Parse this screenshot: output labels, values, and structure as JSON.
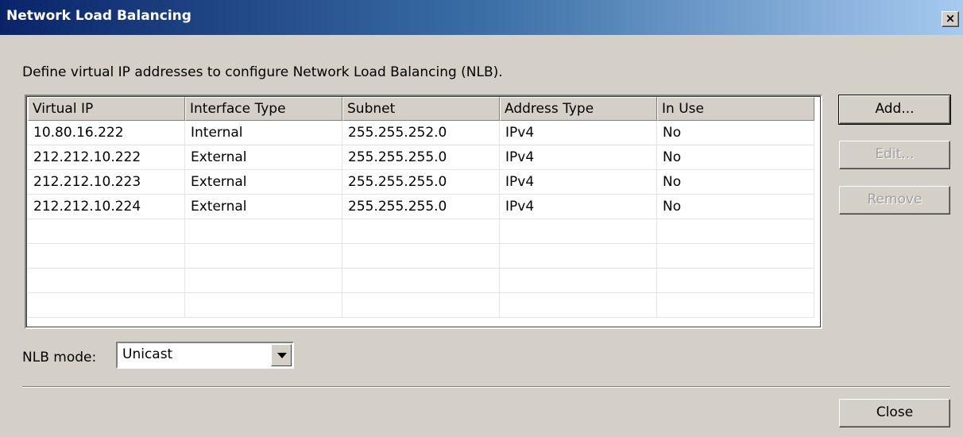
{
  "window": {
    "title": "Network Load Balancing",
    "close_glyph": "×"
  },
  "description": "Define virtual IP addresses to configure Network Load Balancing (NLB).",
  "table": {
    "columns": [
      "Virtual IP",
      "Interface Type",
      "Subnet",
      "Address Type",
      "In Use"
    ],
    "rows": [
      [
        "10.80.16.222",
        "Internal",
        "255.255.252.0",
        "IPv4",
        "No"
      ],
      [
        "212.212.10.222",
        "External",
        "255.255.255.0",
        "IPv4",
        "No"
      ],
      [
        "212.212.10.223",
        "External",
        "255.255.255.0",
        "IPv4",
        "No"
      ],
      [
        "212.212.10.224",
        "External",
        "255.255.255.0",
        "IPv4",
        "No"
      ]
    ]
  },
  "buttons": {
    "add": "Add...",
    "edit": "Edit...",
    "remove": "Remove",
    "close": "Close"
  },
  "nlb_mode": {
    "label": "NLB mode:",
    "value": "Unicast"
  },
  "colors": {
    "title_gradient_start": "#0a246a",
    "title_gradient_end": "#a6caf0",
    "dialog_background": "#d4d0c8",
    "disabled_text": "#a0a0a0"
  }
}
